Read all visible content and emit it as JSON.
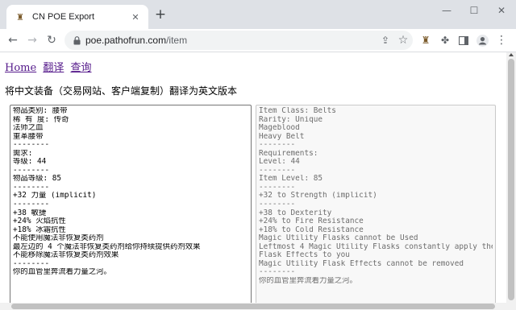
{
  "browser": {
    "tab_title": "CN POE Export",
    "url_domain": "poe.pathofrun.com",
    "url_path": "/item",
    "icons": {
      "favicon": "poe-tab-favicon",
      "back": "back-arrow-icon",
      "forward": "forward-arrow-icon",
      "reload": "reload-icon",
      "lock": "lock-icon",
      "share": "share-icon",
      "bookmark": "star-icon",
      "extension_poe": "poe-extension-icon",
      "extensions": "puzzle-icon",
      "sidepanel": "sidepanel-icon",
      "profile": "profile-icon",
      "menu": "kebab-menu-icon"
    },
    "glyphs": {
      "close": "✕",
      "newtab": "+",
      "minimize": "—",
      "maximize": "☐",
      "winclose": "✕",
      "back": "←",
      "forward": "→",
      "reload": "↻",
      "share": "⇪",
      "star": "☆",
      "favicon": "♜",
      "puzzle": "✤",
      "menu": "⋮"
    }
  },
  "nav": {
    "home": "Home",
    "translate": "翻译",
    "query": "查询"
  },
  "subtitle": "将中文装备（交易网站、客户端复制）翻译为英文版本",
  "input_lines": [
    "物品类别: 腰带",
    "稀 有 度: 传奇",
    "法师之血",
    "重革腰带",
    "--------",
    "需求:",
    "等级: 44",
    "--------",
    "物品等级: 85",
    "--------",
    "+32 力量 (implicit)",
    "--------",
    "+38 敏捷",
    "+24% 火焰抗性",
    "+18% 冰霜抗性",
    "不能使用魔法非恢复类药剂",
    "最左边的 4 个魔法非恢复类药剂给你持续提供药剂效果",
    "不能移除魔法非恢复类药剂效果",
    "--------",
    "你的血管里奔流着力量之河。"
  ],
  "output_lines": [
    "Item Class: Belts",
    "Rarity: Unique",
    "Mageblood",
    "Heavy Belt",
    "--------",
    "Requirements:",
    "Level: 44",
    "--------",
    "Item Level: 85",
    "--------",
    "+32 to Strength (implicit)",
    "--------",
    "+38 to Dexterity",
    "+24% to Fire Resistance",
    "+18% to Cold Resistance",
    "Magic Utility Flasks cannot be Used",
    "Leftmost 4 Magic Utility Flasks constantly apply their",
    "Flask Effects to you",
    "Magic Utility Flask Effects cannot be removed",
    "--------",
    "你的血管里奔流着力量之河。"
  ]
}
